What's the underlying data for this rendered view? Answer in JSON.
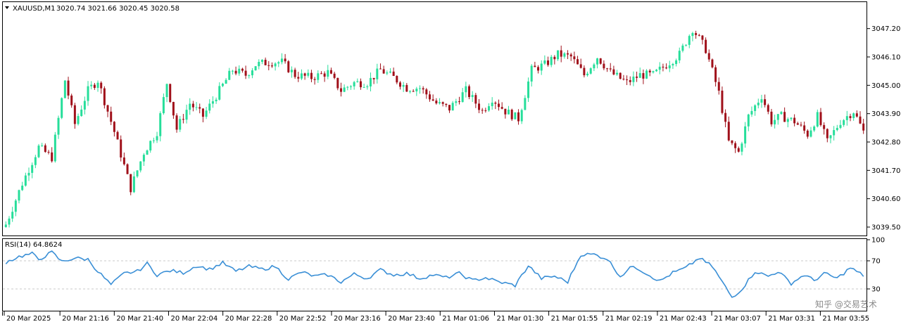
{
  "header": {
    "symbol_label": "XAUUSD,M1",
    "ohlc_label": "3020.74 3021.66 3020.45 3020.58"
  },
  "rsi_panel": {
    "label": "RSI(14) 64.8624"
  },
  "watermark": {
    "text": "知乎 @交易艺术"
  },
  "colors": {
    "bull": "#26de9a",
    "bear": "#a0101a",
    "rsi_line": "#3a8fd6",
    "level_line": "#c8c8c8",
    "frame": "#000000"
  },
  "chart_data": [
    {
      "type": "candlestick",
      "symbol": "XAUUSD",
      "timeframe": "M1",
      "ylim": [
        3039.2,
        3048.2
      ],
      "yticks": [
        "3047.20",
        "3046.10",
        "3045.00",
        "3043.90",
        "3042.80",
        "3041.70",
        "3040.60",
        "3039.50"
      ],
      "ytick_values": [
        3047.2,
        3046.1,
        3045.0,
        3043.9,
        3042.8,
        3041.7,
        3040.6,
        3039.5
      ],
      "x_tick_labels": [
        "20 Mar 2025",
        "20 Mar 21:16",
        "20 Mar 21:40",
        "20 Mar 22:04",
        "20 Mar 22:28",
        "20 Mar 22:52",
        "20 Mar 23:16",
        "20 Mar 23:40",
        "21 Mar 01:06",
        "21 Mar 01:30",
        "21 Mar 01:55",
        "21 Mar 02:19",
        "21 Mar 02:43",
        "21 Mar 03:07",
        "21 Mar 03:31",
        "21 Mar 03:55"
      ],
      "close_path": [
        [
          0,
          3039.6
        ],
        [
          5,
          3041.2
        ],
        [
          10,
          3042.6
        ],
        [
          14,
          3042.2
        ],
        [
          18,
          3045.2
        ],
        [
          21,
          3043.5
        ],
        [
          25,
          3044.8
        ],
        [
          28,
          3045.2
        ],
        [
          33,
          3043.2
        ],
        [
          38,
          3041.0
        ],
        [
          42,
          3042.4
        ],
        [
          46,
          3043.2
        ],
        [
          49,
          3045.1
        ],
        [
          52,
          3043.3
        ],
        [
          56,
          3044.3
        ],
        [
          60,
          3043.8
        ],
        [
          64,
          3044.6
        ],
        [
          69,
          3045.6
        ],
        [
          73,
          3045.4
        ],
        [
          76,
          3045.8
        ],
        [
          80,
          3045.9
        ],
        [
          84,
          3045.9
        ],
        [
          88,
          3045.4
        ],
        [
          93,
          3045.3
        ],
        [
          98,
          3045.5
        ],
        [
          102,
          3044.8
        ],
        [
          106,
          3045.1
        ],
        [
          110,
          3045.1
        ],
        [
          114,
          3045.6
        ],
        [
          118,
          3045.3
        ],
        [
          122,
          3044.9
        ],
        [
          126,
          3044.9
        ],
        [
          131,
          3044.3
        ],
        [
          135,
          3044.1
        ],
        [
          140,
          3044.8
        ],
        [
          145,
          3044.0
        ],
        [
          148,
          3044.5
        ],
        [
          152,
          3044.0
        ],
        [
          156,
          3043.7
        ],
        [
          160,
          3045.6
        ],
        [
          164,
          3045.8
        ],
        [
          168,
          3046.2
        ],
        [
          172,
          3046.1
        ],
        [
          176,
          3045.4
        ],
        [
          180,
          3046.1
        ],
        [
          184,
          3045.5
        ],
        [
          189,
          3045.1
        ],
        [
          193,
          3045.4
        ],
        [
          197,
          3045.4
        ],
        [
          201,
          3045.8
        ],
        [
          205,
          3046.2
        ],
        [
          209,
          3047.2
        ],
        [
          213,
          3046.4
        ],
        [
          217,
          3044.7
        ],
        [
          220,
          3042.8
        ],
        [
          223,
          3042.4
        ],
        [
          226,
          3043.8
        ],
        [
          230,
          3044.6
        ],
        [
          233,
          3043.6
        ],
        [
          236,
          3043.8
        ],
        [
          240,
          3043.6
        ],
        [
          244,
          3043.1
        ],
        [
          247,
          3043.8
        ],
        [
          250,
          3042.8
        ],
        [
          254,
          3043.6
        ],
        [
          258,
          3044.0
        ],
        [
          261,
          3043.2
        ]
      ],
      "candle_count": 262
    },
    {
      "type": "line",
      "name": "RSI(14)",
      "last_value": 64.8624,
      "ylim": [
        0,
        100
      ],
      "yticks": [
        "100",
        "70",
        "30"
      ],
      "levels": [
        70,
        30
      ],
      "path": [
        [
          0,
          68
        ],
        [
          4,
          76
        ],
        [
          8,
          80
        ],
        [
          10,
          72
        ],
        [
          14,
          82
        ],
        [
          17,
          69
        ],
        [
          21,
          74
        ],
        [
          25,
          72
        ],
        [
          28,
          55
        ],
        [
          32,
          36
        ],
        [
          36,
          52
        ],
        [
          40,
          55
        ],
        [
          43,
          66
        ],
        [
          46,
          50
        ],
        [
          50,
          56
        ],
        [
          54,
          53
        ],
        [
          58,
          63
        ],
        [
          62,
          58
        ],
        [
          66,
          67
        ],
        [
          70,
          55
        ],
        [
          74,
          62
        ],
        [
          78,
          58
        ],
        [
          82,
          62
        ],
        [
          86,
          44
        ],
        [
          90,
          54
        ],
        [
          94,
          48
        ],
        [
          98,
          50
        ],
        [
          102,
          40
        ],
        [
          106,
          51
        ],
        [
          110,
          45
        ],
        [
          114,
          57
        ],
        [
          118,
          50
        ],
        [
          122,
          52
        ],
        [
          126,
          45
        ],
        [
          130,
          50
        ],
        [
          134,
          46
        ],
        [
          138,
          52
        ],
        [
          142,
          42
        ],
        [
          146,
          46
        ],
        [
          150,
          40
        ],
        [
          155,
          35
        ],
        [
          159,
          63
        ],
        [
          163,
          45
        ],
        [
          167,
          48
        ],
        [
          171,
          40
        ],
        [
          175,
          79
        ],
        [
          179,
          79
        ],
        [
          183,
          73
        ],
        [
          187,
          48
        ],
        [
          191,
          63
        ],
        [
          195,
          52
        ],
        [
          199,
          41
        ],
        [
          203,
          53
        ],
        [
          207,
          60
        ],
        [
          211,
          74
        ],
        [
          215,
          62
        ],
        [
          218,
          40
        ],
        [
          221,
          18
        ],
        [
          224,
          30
        ],
        [
          228,
          55
        ],
        [
          232,
          48
        ],
        [
          235,
          55
        ],
        [
          239,
          38
        ],
        [
          243,
          50
        ],
        [
          246,
          42
        ],
        [
          249,
          52
        ],
        [
          253,
          45
        ],
        [
          257,
          60
        ],
        [
          261,
          49
        ]
      ]
    }
  ]
}
